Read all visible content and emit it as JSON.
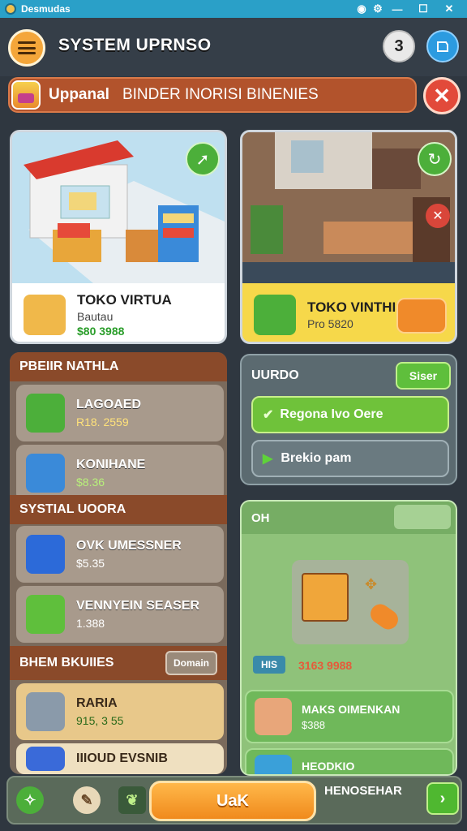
{
  "window": {
    "title": "Desmudas",
    "minimize_glyph": "—",
    "maximize_glyph": "☐",
    "close_glyph": "✕"
  },
  "header": {
    "title": "SYSTEM UPRNSO",
    "help_label": "3",
    "settings_icon": "settings-icon"
  },
  "banner": {
    "label": "Uppanal",
    "text": "BINDER INORISI BINENIES",
    "close_glyph": "✕"
  },
  "stores": [
    {
      "name": "TOKO VIRTUA",
      "subtitle": "Bautau",
      "price": "$80 3988"
    },
    {
      "name": "TOKO VINTHIS",
      "subtitle": "Pro 5820",
      "price": ""
    }
  ],
  "left_panel": {
    "sections": [
      {
        "title": "PBEIIR NATHLA",
        "items": [
          {
            "name": "LAGOAED",
            "price": "R18. 2559"
          },
          {
            "name": "KONIHANE",
            "price": "$8.36"
          }
        ]
      },
      {
        "title": "SYSTIAL UOORA",
        "items": [
          {
            "name": "OVK UMESSNER",
            "price": "$5.35"
          },
          {
            "name": "VENNYEIN SEASER",
            "price": "1.388"
          }
        ]
      },
      {
        "title": "BHEM BKUIIES",
        "button": "Domain",
        "items": [
          {
            "name": "RARIA",
            "price": "915, 3 55"
          },
          {
            "name": "IIIOUD EVSNIB",
            "price": ""
          }
        ]
      }
    ]
  },
  "right_top": {
    "title": "UURDO",
    "small_button": "Siser",
    "primary_action": "Regona Ivo Oere",
    "secondary_action": "Brekio pam"
  },
  "right_bottom": {
    "title": "OH",
    "badge": "HIS",
    "price": "3163 9988",
    "items": [
      {
        "name": "MAKS OIMENKAN",
        "price": "$388"
      },
      {
        "name": "HEODKIO",
        "price": ""
      }
    ]
  },
  "bottom_bar": {
    "main_button": "UaK",
    "right_text": "HENOSEHAR",
    "next_glyph": "›"
  },
  "colors": {
    "accent": "#f4a63a",
    "panel_brown": "#8a4a2a",
    "panel_green": "#8fc27a",
    "titlebar": "#2aa0c8"
  }
}
